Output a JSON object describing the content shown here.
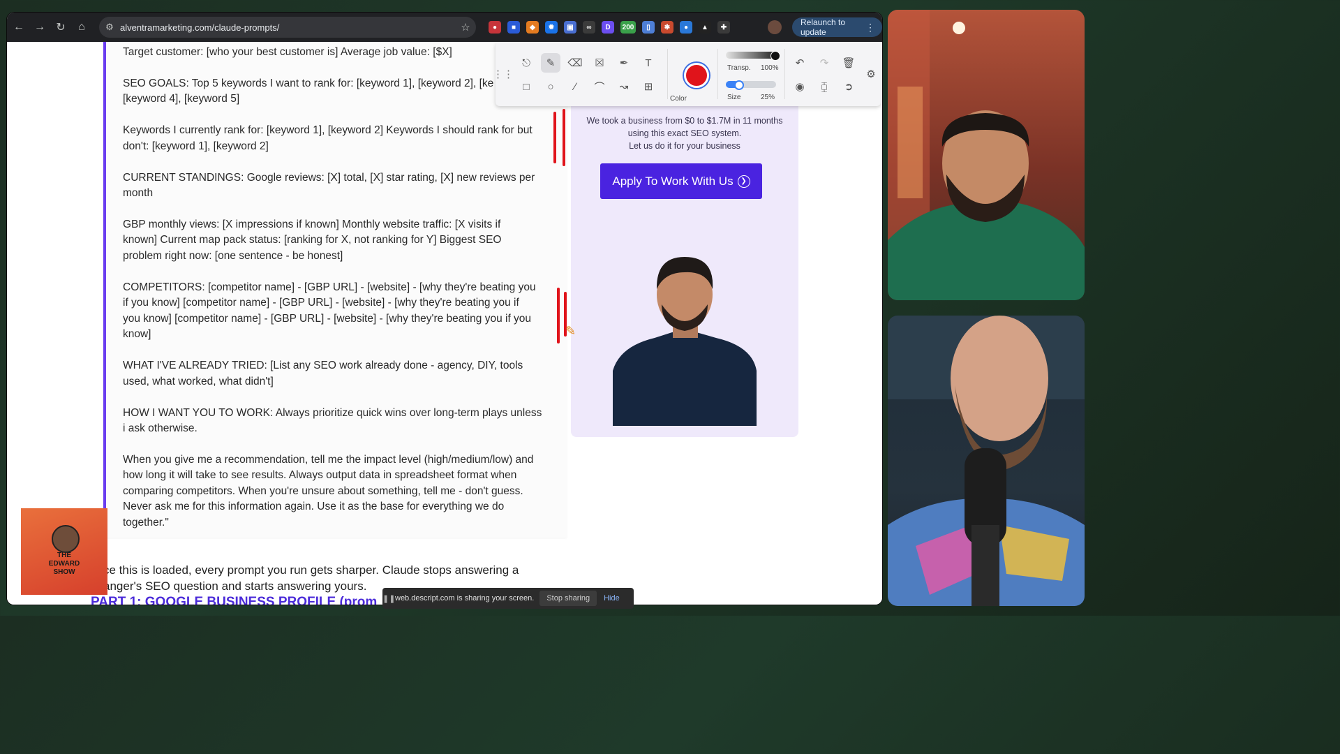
{
  "browser": {
    "url": "alventramarketing.com/claude-prompts/",
    "relaunch_label": "Relaunch to update",
    "extension_badge": "200"
  },
  "prompt": {
    "lines": [
      "Target customer: [who your best customer is] Average job value: [$X]",
      "SEO GOALS: Top 5 keywords I want to rank for: [keyword 1], [keyword 2], [ke",
      "[keyword 4], [keyword 5]",
      "Keywords I currently rank for: [keyword 1], [keyword 2] Keywords I should rank for but",
      "don't: [keyword 1], [keyword 2]",
      "CURRENT STANDINGS: Google reviews: [X] total, [X] star rating, [X] new reviews per",
      "month",
      "GBP monthly views: [X impressions if known] Monthly website traffic: [X visits if",
      "known] Current map pack status: [ranking for X, not ranking for Y] Biggest SEO",
      "problem right now: [one sentence - be honest]",
      "COMPETITORS: [competitor name] - [GBP URL] - [website] - [why they're beating you",
      "if you know] [competitor name] - [GBP URL] - [website] - [why they're beating you if",
      "you know] [competitor name] - [GBP URL] - [website] - [why they're beating you if you",
      "know]",
      "WHAT I'VE ALREADY TRIED: [List any SEO work already done - agency, DIY, tools",
      "used, what worked, what didn't]",
      "HOW I WANT YOU TO WORK: Always prioritize quick wins over long-term plays unless",
      "i ask otherwise.",
      "When you give me a recommendation, tell me the impact level (high/medium/low) and",
      "how long it will take to see results. Always output data in spreadsheet format when",
      "comparing competitors. When you're unsure about something, tell me - don't guess.",
      "Never ask me for this information again. Use it as the base for everything we do",
      "together.\""
    ]
  },
  "after_text": {
    "line1": "ce this is loaded, every prompt you run gets sharper. Claude stops answering a",
    "line2": "anger's SEO question and starts answering yours."
  },
  "part_heading": "PART 1: GOOGLE BUSINESS PROFILE (prom",
  "promo": {
    "line1": "We took a business from $0 to $1.7M in 11 months",
    "line2": "using this exact SEO system.",
    "line3": "Let us do it for your business",
    "button": "Apply To Work With Us"
  },
  "annotation": {
    "color_label": "Color",
    "transp_label": "Transp.",
    "transp_value": "100%",
    "size_label": "Size",
    "size_value": "25%",
    "transp_fraction": 1.0,
    "size_fraction": 0.25,
    "active_color": "#e0141b"
  },
  "share_bar": {
    "message": "web.descript.com is sharing your screen.",
    "stop_label": "Stop sharing",
    "hide_label": "Hide"
  },
  "show_logo": {
    "title_line1": "THE",
    "title_line2": "EDWARD",
    "title_line3": "SHOW"
  }
}
